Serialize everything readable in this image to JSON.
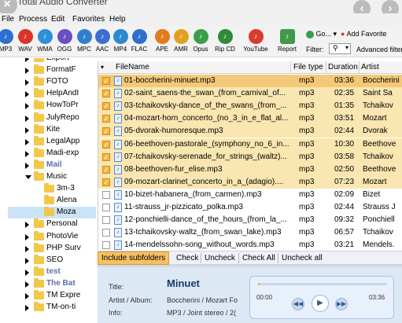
{
  "window": {
    "title": "Total Audio Converter"
  },
  "menu": [
    "File",
    "Process",
    "Edit",
    "Favorites",
    "Help"
  ],
  "toolbar": {
    "formats": [
      {
        "label": "MP3",
        "color": "#2d6fd0"
      },
      {
        "label": "WAV",
        "color": "#d9342b"
      },
      {
        "label": "WMA",
        "color": "#2b8fd9"
      },
      {
        "label": "OGG",
        "color": "#6a4fc0"
      },
      {
        "label": "MPC",
        "color": "#2f7fd0"
      },
      {
        "label": "AAC",
        "color": "#3a6fd0"
      },
      {
        "label": "MP4",
        "color": "#2a8ad0"
      },
      {
        "label": "FLAC",
        "color": "#2e6fce"
      },
      {
        "label": "APE",
        "color": "#e07b1e"
      },
      {
        "label": "AMR",
        "color": "#e0a21e"
      },
      {
        "label": "Opus",
        "color": "#3a9e48"
      },
      {
        "label": "Rip CD",
        "color": "#2f8a3a"
      },
      {
        "label": "YouTube",
        "color": "#d93a30"
      },
      {
        "label": "Report",
        "color": "#3f9a4b"
      }
    ],
    "go_label": "Go...",
    "add_favorite_label": "Add Favorite",
    "filter_label": "Filter:",
    "advanced_filter_label": "Advanced filter"
  },
  "tree": {
    "items": [
      {
        "label": "Export",
        "bold": false,
        "expanded": false
      },
      {
        "label": "FormatF",
        "bold": false,
        "expanded": false
      },
      {
        "label": "FOTO",
        "bold": false,
        "expanded": false
      },
      {
        "label": "HelpAndI",
        "bold": false,
        "expanded": false
      },
      {
        "label": "HowToPr",
        "bold": false,
        "expanded": false
      },
      {
        "label": "JulyRepo",
        "bold": false,
        "expanded": false
      },
      {
        "label": "Kite",
        "bold": false,
        "expanded": false
      },
      {
        "label": "LegalApp",
        "bold": false,
        "expanded": false
      },
      {
        "label": "Madi-exp",
        "bold": false,
        "expanded": false
      },
      {
        "label": "Mail",
        "bold": true,
        "expanded": false
      },
      {
        "label": "Music",
        "bold": false,
        "expanded": true
      },
      {
        "label": "3m-3",
        "bold": false,
        "expanded": false
      },
      {
        "label": "Alena",
        "bold": false,
        "expanded": false
      },
      {
        "label": "Moza",
        "bold": false,
        "expanded": false
      },
      {
        "label": "Personal",
        "bold": false,
        "expanded": false
      },
      {
        "label": "PhotoVie",
        "bold": false,
        "expanded": false
      },
      {
        "label": "PHP Surv",
        "bold": false,
        "expanded": false
      },
      {
        "label": "SEO",
        "bold": false,
        "expanded": false
      },
      {
        "label": "test",
        "bold": true,
        "expanded": false
      },
      {
        "label": "The Bat",
        "bold": true,
        "expanded": false
      },
      {
        "label": "TM Expre",
        "bold": false,
        "expanded": false
      },
      {
        "label": "TM-on-ti",
        "bold": false,
        "expanded": false
      }
    ]
  },
  "list": {
    "columns": [
      "FileName",
      "File type",
      "Duration",
      "Artist"
    ],
    "rows": [
      {
        "name": "01-boccherini-minuet.mp3",
        "type": "mp3",
        "duration": "03:36",
        "artist": "Boccherini",
        "checked": true
      },
      {
        "name": "02-saint_saens-the_swan_(from_carnival_of...",
        "type": "mp3",
        "duration": "02:35",
        "artist": "Saint Sa",
        "checked": true
      },
      {
        "name": "03-tchaikovsky-dance_of_the_swans_(from_...",
        "type": "mp3",
        "duration": "01:35",
        "artist": "Tchaikov",
        "checked": true
      },
      {
        "name": "04-mozart-horn_concerto_(no_3_in_e_flat_al...",
        "type": "mp3",
        "duration": "03:51",
        "artist": "Mozart",
        "checked": true
      },
      {
        "name": "05-dvorak-humoresque.mp3",
        "type": "mp3",
        "duration": "02:44",
        "artist": "Dvorak",
        "checked": true
      },
      {
        "name": "06-beethoven-pastorale_(symphony_no_6_in...",
        "type": "mp3",
        "duration": "10:30",
        "artist": "Beethove",
        "checked": true
      },
      {
        "name": "07-tchaikovsky-serenade_for_strings_(waltz)...",
        "type": "mp3",
        "duration": "03:58",
        "artist": "Tchaikov",
        "checked": true
      },
      {
        "name": "08-beethoven-fur_elise.mp3",
        "type": "mp3",
        "duration": "02:50",
        "artist": "Beethove",
        "checked": true
      },
      {
        "name": "09-mozart-clarinet_concerto_in_a_(adagio)....",
        "type": "mp3",
        "duration": "07:23",
        "artist": "Mozart",
        "checked": true
      },
      {
        "name": "10-bizet-habanera_(from_carmen).mp3",
        "type": "mp3",
        "duration": "02:09",
        "artist": "Bizet",
        "checked": false
      },
      {
        "name": "11-strauss_jr-pizzicato_polka.mp3",
        "type": "mp3",
        "duration": "02:44",
        "artist": "Strauss J",
        "checked": false
      },
      {
        "name": "12-ponchielli-dance_of_the_hours_(from_la_...",
        "type": "mp3",
        "duration": "09:32",
        "artist": "Ponchiell",
        "checked": false
      },
      {
        "name": "13-tchaikovsky-waltz_(from_swan_lake).mp3",
        "type": "mp3",
        "duration": "06:57",
        "artist": "Tchaikov",
        "checked": false
      },
      {
        "name": "14-mendelssohn-song_without_words.mp3",
        "type": "mp3",
        "duration": "03:21",
        "artist": "Mendels.",
        "checked": false
      }
    ]
  },
  "actions": {
    "include_subfolders": "Include subfolders",
    "check": "Check",
    "uncheck": "Uncheck",
    "check_all": "Check All",
    "uncheck_all": "Uncheck all"
  },
  "info": {
    "title_label": "Title:",
    "title_value": "Minuet",
    "artist_album_label": "Artist / Album:",
    "artist_album_value": "Boccherini / Mozart Fo",
    "info_label": "Info:",
    "info_value": "MP3 / Joint stereo / 2("
  },
  "player": {
    "current_time": "00:00",
    "total_time": "03:36",
    "progress": 0.0
  },
  "colors": {
    "checked_row": "#f9e6b0",
    "selected_row": "#f3c979",
    "accent": "#f7c065"
  }
}
